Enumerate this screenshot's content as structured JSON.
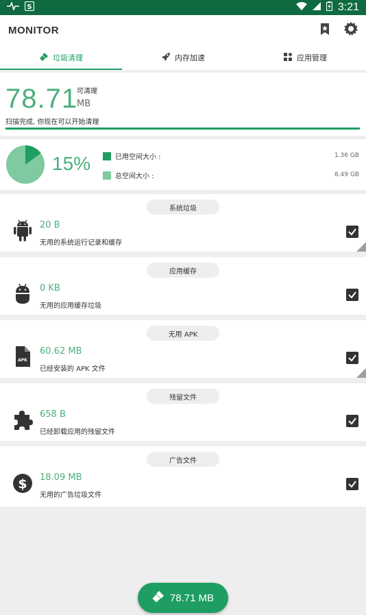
{
  "status_bar": {
    "time": "3:21"
  },
  "app": {
    "title": "MONITOR"
  },
  "tabs": [
    {
      "label": "垃圾清理",
      "icon": "broom-icon",
      "active": true
    },
    {
      "label": "内存加速",
      "icon": "rocket-icon",
      "active": false
    },
    {
      "label": "应用管理",
      "icon": "apps-icon",
      "active": false
    }
  ],
  "summary": {
    "total": "78.71",
    "can_clean_label": "可清理",
    "unit": "MB",
    "scan_message": "扫描完成, 你现在可以开始清理",
    "progress": 1.0
  },
  "storage": {
    "percent_text": "15%",
    "used_fraction": 0.15,
    "used_label": "已用空间大小 :",
    "used_value": "1.36 GB",
    "total_label": "总空间大小 :",
    "total_value": "8.49 GB",
    "colors": {
      "used": "#1e9e62",
      "total": "#7fcaa0"
    }
  },
  "junk": [
    {
      "category": "系统垃圾",
      "size": "20 B",
      "desc": "无用的系统运行记录和缓存",
      "icon": "android-icon",
      "checked": true
    },
    {
      "category": "应用缓存",
      "size": "0 KB",
      "desc": "无用的应用缓存垃圾",
      "icon": "android-head-icon",
      "checked": true
    },
    {
      "category": "无用 APK",
      "size": "60.62 MB",
      "desc": "已经安装的 APK 文件",
      "icon": "apk-file-icon",
      "checked": true
    },
    {
      "category": "残留文件",
      "size": "658 B",
      "desc": "已经卸载应用的残留文件",
      "icon": "puzzle-icon",
      "checked": true
    },
    {
      "category": "广告文件",
      "size": "18.09 MB",
      "desc": "无用的广告垃圾文件",
      "icon": "dollar-icon",
      "checked": true
    }
  ],
  "fab": {
    "label": "78.71 MB"
  },
  "colors": {
    "accent": "#1e9e62",
    "status_bar": "#0f6b3f",
    "text_green": "#4caf7d"
  }
}
